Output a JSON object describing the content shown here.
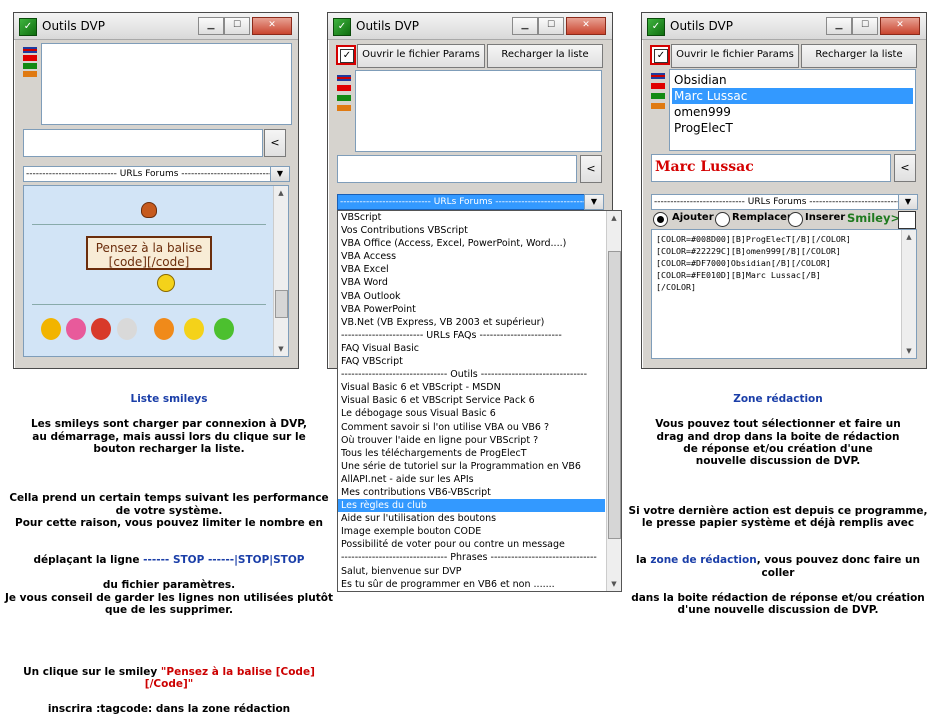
{
  "windows": [
    {
      "title": "Outils DVP"
    },
    {
      "title": "Outils DVP",
      "open_params": "Ouvrir le fichier Params",
      "reload_list": "Recharger la liste",
      "combo_value": "---------------------------- URLs Forums ----------------------------"
    },
    {
      "title": "Outils DVP",
      "open_params": "Ouvrir le fichier Params",
      "reload_list": "Recharger la liste",
      "combo_value": "---------------------------- URLs Forums ----------------------------"
    }
  ],
  "window1": {
    "combo_value": "---------------------------- URLs Forums ----------------------------",
    "speech_bubble": "Pensez à la balise\n[code][/code]",
    "small_button": "<"
  },
  "window2": {
    "small_button": "<",
    "dropdown_items": [
      {
        "label": "VBScript",
        "selected": false
      },
      {
        "label": "Vos Contributions VBScript",
        "selected": false
      },
      {
        "label": "VBA Office (Access, Excel, PowerPoint, Word....)",
        "selected": false
      },
      {
        "label": "VBA Access",
        "selected": false
      },
      {
        "label": "VBA Excel",
        "selected": false
      },
      {
        "label": "VBA Word",
        "selected": false
      },
      {
        "label": "VBA Outlook",
        "selected": false
      },
      {
        "label": "VBA PowerPoint",
        "selected": false
      },
      {
        "label": "VB.Net (VB Express, VB 2003 et supérieur)",
        "selected": false
      },
      {
        "label": "------------------------ URLs FAQs ------------------------",
        "selected": false
      },
      {
        "label": "FAQ Visual Basic",
        "selected": false
      },
      {
        "label": "FAQ VBScript",
        "selected": false
      },
      {
        "label": "------------------------------- Outils -------------------------------",
        "selected": false
      },
      {
        "label": "Visual Basic 6 et VBScript - MSDN",
        "selected": false
      },
      {
        "label": "Visual Basic 6 et VBScript Service Pack 6",
        "selected": false
      },
      {
        "label": "Le débogage sous Visual Basic 6",
        "selected": false
      },
      {
        "label": "Comment savoir si l'on utilise VBA  ou VB6 ?",
        "selected": false
      },
      {
        "label": "Où trouver l'aide en ligne pour VBScript ?",
        "selected": false
      },
      {
        "label": "Tous les téléchargements de ProgElecT",
        "selected": false
      },
      {
        "label": "Une série de tutoriel sur la Programmation en VB6",
        "selected": false
      },
      {
        "label": "AllAPI.net - aide sur les APIs",
        "selected": false
      },
      {
        "label": "Mes contributions VB6-VBScript",
        "selected": false
      },
      {
        "label": "Les règles du club",
        "selected": true
      },
      {
        "label": "Aide sur l'utilisation des boutons",
        "selected": false
      },
      {
        "label": "Image exemple bouton CODE",
        "selected": false
      },
      {
        "label": "Possibilité de voter pour ou contre un message",
        "selected": false
      },
      {
        "label": "------------------------------- Phrases -------------------------------",
        "selected": false
      },
      {
        "label": "Salut, bienvenue sur DVP",
        "selected": false
      },
      {
        "label": "Es tu sûr de programmer en VB6 et non .......",
        "selected": false
      }
    ]
  },
  "window3": {
    "members": [
      {
        "name": "Obsidian",
        "selected": false
      },
      {
        "name": "Marc Lussac",
        "selected": true
      },
      {
        "name": "omen999",
        "selected": false
      },
      {
        "name": "ProgElecT",
        "selected": false
      }
    ],
    "name_field": "Marc Lussac",
    "small_button": "<",
    "radio_add": "Ajouter",
    "radio_replace": "Remplacer",
    "radio_insert": "Inserer",
    "smiley_label": "Smiley>",
    "editor_lines": [
      "[COLOR=#008D00][B]ProgElecT[/B][/COLOR]",
      "[COLOR=#22229C][B]omen999[/B][/COLOR]",
      "[COLOR=#DF7000]Obsidian[/B][/COLOR]",
      "[COLOR=#FE010D][B]Marc Lussac[/B]",
      "[/COLOR]"
    ]
  },
  "captions": {
    "left": {
      "title": "Liste smileys",
      "p1": "Les smileys sont charger par connexion à DVP,\nau démarrage, mais aussi  lors du clique sur le\nbouton recharger la liste.",
      "p2": "Cella prend un certain temps suivant les performance\nde votre système.\nPour cette raison, vous pouvez limiter le nombre en",
      "p2_line_pre": "déplaçant la ligne  ",
      "p2_line_code": "------ STOP ------|STOP|STOP",
      "p3": "du fichier paramètres.\nJe vous conseil de garder les lignes non utilisées plutôt\nque de les supprimer.",
      "p4_pre": "Un clique sur le smiley ",
      "p4_quote": "\"Pensez à la balise [Code][/Code]\"",
      "p4_post": "inscrira :tagcode: dans la zone rédaction"
    },
    "right": {
      "title": "Zone rédaction",
      "p1": "Vous pouvez tout sélectionner et faire un\ndrag and drop dans la boite de rédaction\nde réponse et/ou création d'une\nnouvelle discussion  de DVP.",
      "p2": "Si votre dernière action est depuis ce programme,\nle presse papier système et déjà remplis avec",
      "p2_pre": "la ",
      "p2_link": "zone de rédaction",
      "p2_post": ", vous pouvez donc faire un coller",
      "p3": "dans la boite rédaction de réponse et/ou création\nd'une nouvelle discussion  de DVP."
    }
  },
  "colors": {
    "selection": "#3399ff",
    "name_red": "#d40000",
    "smiley_green": "#1f7a1f",
    "caption_blue": "#1a3ea8"
  }
}
